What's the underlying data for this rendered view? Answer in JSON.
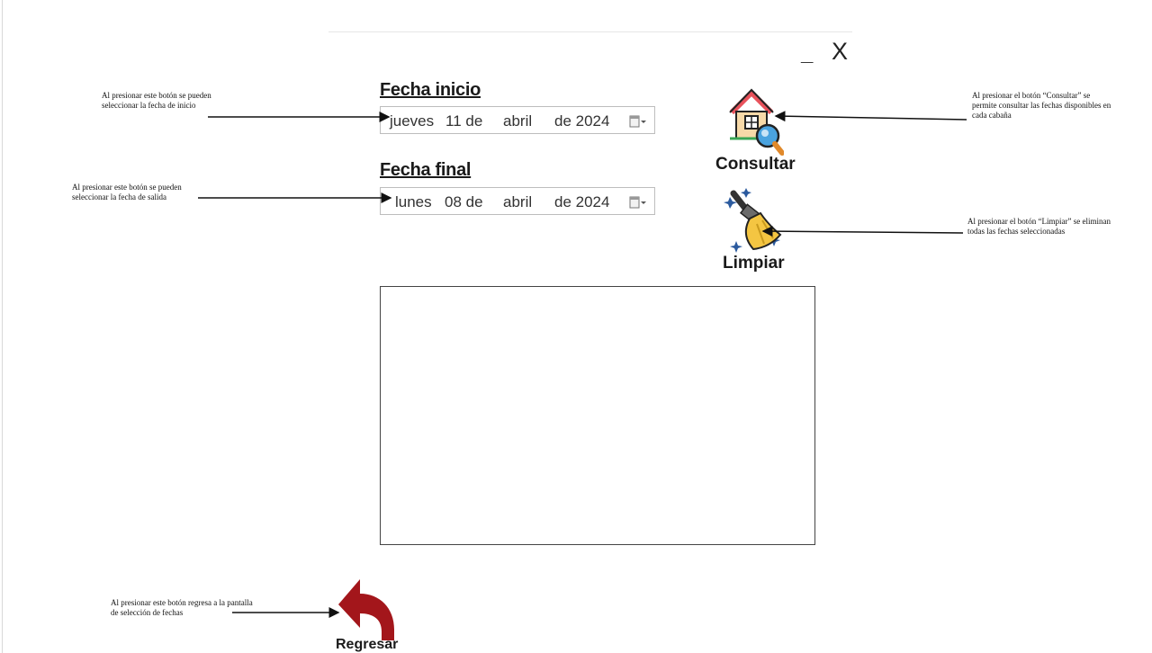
{
  "window_controls": {
    "minimize": "_",
    "close": "X"
  },
  "fecha_inicio": {
    "label": "Fecha inicio",
    "weekday": "jueves",
    "day": "11 de",
    "month": "abril",
    "year": "de 2024"
  },
  "fecha_final": {
    "label": "Fecha final",
    "weekday": "lunes",
    "day": "08 de",
    "month": "abril",
    "year": "de 2024"
  },
  "buttons": {
    "consultar": "Consultar",
    "limpiar": "Limpiar",
    "regresar": "Regresar"
  },
  "annotations": {
    "inicio": [
      "Al presionar este botón se pueden",
      "seleccionar la fecha de inicio"
    ],
    "final": [
      "Al presionar este botón se pueden",
      "seleccionar la fecha de salida"
    ],
    "consultar": [
      "Al presionar el botón “Consultar” se",
      "permite consultar las fechas disponibles en",
      "cada cabaña"
    ],
    "limpiar": [
      "Al presionar el botón “Limpiar” se eliminan",
      "todas las fechas seleccionadas"
    ],
    "regresar": [
      "Al presionar este botón regresa a la pantalla",
      "de selección de fechas"
    ]
  },
  "colors": {
    "house_roof": "#e8525b",
    "magnifier": "#4aa3df",
    "broom_head": "#f4c542",
    "back_arrow": "#a3161b"
  }
}
